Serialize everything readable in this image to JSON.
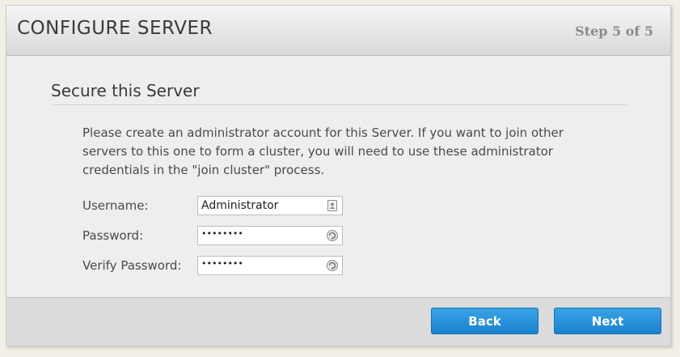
{
  "header": {
    "title": "CONFIGURE SERVER",
    "step": "Step 5 of 5"
  },
  "section": {
    "title": "Secure this Server",
    "description": "Please create an administrator account for this Server. If you want to join other servers to this one to form a cluster, you will need to use these administrator credentials in the \"join cluster\" process."
  },
  "form": {
    "username": {
      "label": "Username:",
      "value": "Administrator",
      "icon": "contact-card-icon"
    },
    "password": {
      "label": "Password:",
      "value": "••••••••",
      "icon": "password-reveal-icon"
    },
    "verify_password": {
      "label": "Verify Password:",
      "value": "••••••••",
      "icon": "password-reveal-icon"
    }
  },
  "footer": {
    "back_label": "Back",
    "next_label": "Next"
  },
  "colors": {
    "button_blue": "#1a82cf",
    "header_text": "#3a3a3a",
    "step_text": "#8a8a8a"
  }
}
